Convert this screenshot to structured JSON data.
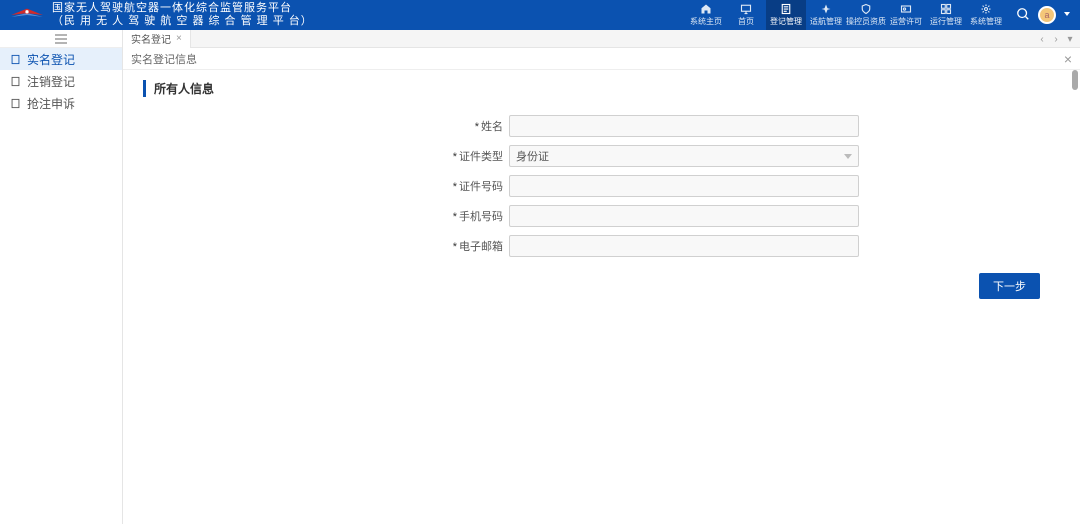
{
  "header": {
    "title_line1": "国家无人驾驶航空器一体化综合监管服务平台",
    "title_line2": "（民 用 无 人 驾 驶 航 空 器 综 合 管 理 平 台）",
    "nav": [
      {
        "label": "系统主页",
        "icon": "home"
      },
      {
        "label": "首页",
        "icon": "monitor"
      },
      {
        "label": "登记管理",
        "icon": "doc"
      },
      {
        "label": "适航管理",
        "icon": "plane"
      },
      {
        "label": "操控员资质",
        "icon": "shield"
      },
      {
        "label": "运营许可",
        "icon": "cert"
      },
      {
        "label": "运行管理",
        "icon": "grid"
      },
      {
        "label": "系统管理",
        "icon": "gear"
      }
    ],
    "nav_active_index": 2,
    "avatar_letter": "a"
  },
  "sidebar": {
    "items": [
      {
        "label": "实名登记"
      },
      {
        "label": "注销登记"
      },
      {
        "label": "抢注申诉"
      }
    ],
    "active_index": 0
  },
  "tabs": {
    "items": [
      {
        "label": "实名登记"
      }
    ]
  },
  "panel": {
    "title": "实名登记信息",
    "section_title": "所有人信息",
    "fields": {
      "name_label": "姓名",
      "idtype_label": "证件类型",
      "idtype_value": "身份证",
      "idnum_label": "证件号码",
      "phone_label": "手机号码",
      "email_label": "电子邮箱"
    },
    "next_button": "下一步"
  }
}
